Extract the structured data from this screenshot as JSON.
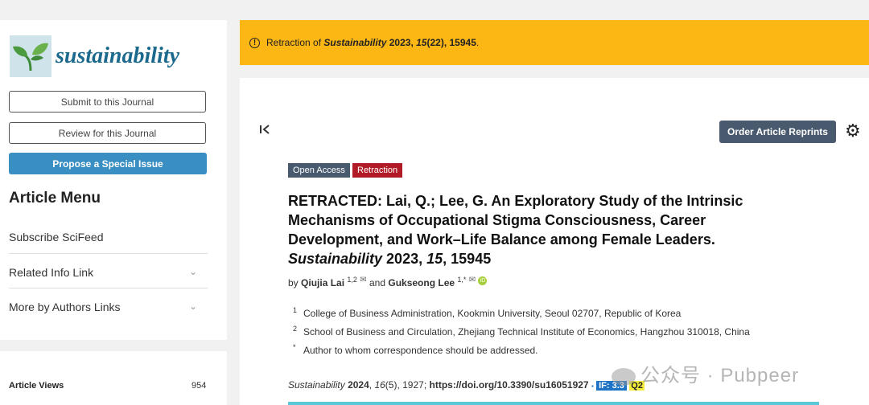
{
  "sidebar": {
    "logo_text": "sustainability",
    "submit_label": "Submit to this Journal",
    "review_label": "Review for this Journal",
    "propose_label": "Propose a Special Issue",
    "menu_title": "Article Menu",
    "menu_items": [
      {
        "label": "Subscribe SciFeed"
      },
      {
        "label": "Related Info Link"
      },
      {
        "label": "More by Authors Links"
      }
    ],
    "views_label": "Article Views",
    "views_value": "954"
  },
  "banner": {
    "prefix": "Retraction of ",
    "journal": "Sustainability",
    "year": "2023",
    "volume": "15",
    "issue": "(22)",
    "article": "15945",
    "end": "."
  },
  "toolbar": {
    "reprints_label": "Order Article Reprints"
  },
  "tags": {
    "open_access": "Open Access",
    "retraction": "Retraction"
  },
  "article": {
    "title_main": "RETRACTED: Lai, Q.; Lee, G. An Exploratory Study of the Intrinsic Mechanisms of Occupational Stigma Consciousness, Career Development, and Work–Life Balance among Female Leaders.",
    "title_journal": "Sustainability",
    "title_year": "2023",
    "title_volume": "15",
    "title_article": "15945",
    "by": "by",
    "author1": "Qiujia Lai",
    "author1_sup": "1,2",
    "and": "and",
    "author2": "Gukseong Lee",
    "author2_sup": "1,*",
    "affiliations": [
      {
        "num": "1",
        "text": "College of Business Administration, Kookmin University, Seoul 02707, Republic of Korea"
      },
      {
        "num": "2",
        "text": "School of Business and Circulation, Zhejiang Technical Institute of Economics, Hangzhou 310018, China"
      },
      {
        "num": "*",
        "text": "Author to whom correspondence should be addressed."
      }
    ],
    "citation_journal": "Sustainability",
    "citation_year": "2024",
    "citation_vol": "16",
    "citation_issue": "(5), 1927; ",
    "doi": "https://doi.org/10.3390/su16051927",
    "if_badge": "IF: 3.3",
    "q_badge": "Q2"
  },
  "watermark": "公众号 · Pubpeer",
  "colors": {
    "banner": "#fdb714",
    "primary_button": "#3a8fc2",
    "retraction_tag": "#b11b27",
    "open_access_tag": "#4a5a6e"
  }
}
